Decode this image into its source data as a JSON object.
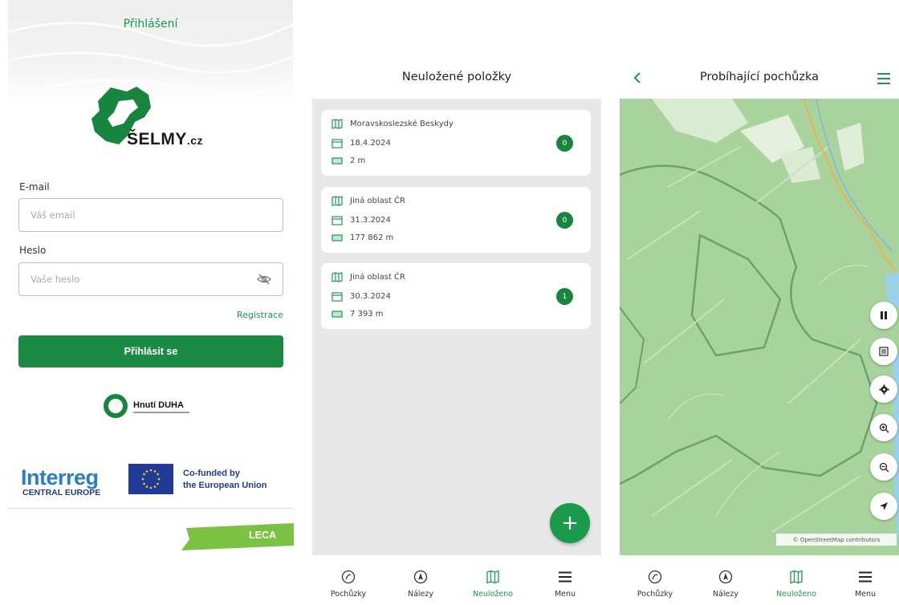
{
  "login": {
    "title": "Přihlášení",
    "logo_text": "ŠELMY",
    "logo_suffix": ".cz",
    "email_label": "E-mail",
    "email_placeholder": "Váš email",
    "password_label": "Heslo",
    "password_placeholder": "Vaše heslo",
    "register_link": "Registrace",
    "login_button": "Přihlásit se",
    "partner_duha": "Hnutí DUHA",
    "interreg_title": "Interreg",
    "interreg_subtitle": "CENTRAL EUROPE",
    "eu_line1": "Co-funded by",
    "eu_line2": "the European Union",
    "leca_badge": "LECA",
    "colors": {
      "accent": "#1b9a4c",
      "button": "#1b8a45",
      "interreg": "#2b7fc1",
      "eu_blue": "#1f3b97"
    }
  },
  "unsaved": {
    "title": "Neuložené položky",
    "items": [
      {
        "area": "Moravskoslezské Beskydy",
        "date": "18.4.2024",
        "distance": "2 m",
        "count": "0"
      },
      {
        "area": "Jiná oblast ČR",
        "date": "31.3.2024",
        "distance": "177 862 m",
        "count": "0"
      },
      {
        "area": "Jiná oblast ČR",
        "date": "30.3.2024",
        "distance": "7 393 m",
        "count": "1"
      }
    ],
    "fab_icon": "+",
    "nav": [
      {
        "label": "Pochůzky",
        "icon": "walk-icon"
      },
      {
        "label": "Nálezy",
        "icon": "compass-icon"
      },
      {
        "label": "Neuloženo",
        "icon": "map-icon",
        "active": true
      },
      {
        "label": "Menu",
        "icon": "hamburger-icon"
      }
    ]
  },
  "map_screen": {
    "title": "Probíhající pochůzka",
    "attribution": "© OpenStreetMap contributors",
    "controls": [
      "pause-icon",
      "list-icon",
      "settings-icon",
      "zoom-in-icon",
      "zoom-out-icon",
      "locate-icon"
    ],
    "nav": [
      {
        "label": "Pochůzky",
        "icon": "walk-icon"
      },
      {
        "label": "Nálezy",
        "icon": "compass-icon"
      },
      {
        "label": "Neuloženo",
        "icon": "map-icon",
        "active": true
      },
      {
        "label": "Menu",
        "icon": "hamburger-icon"
      }
    ]
  }
}
